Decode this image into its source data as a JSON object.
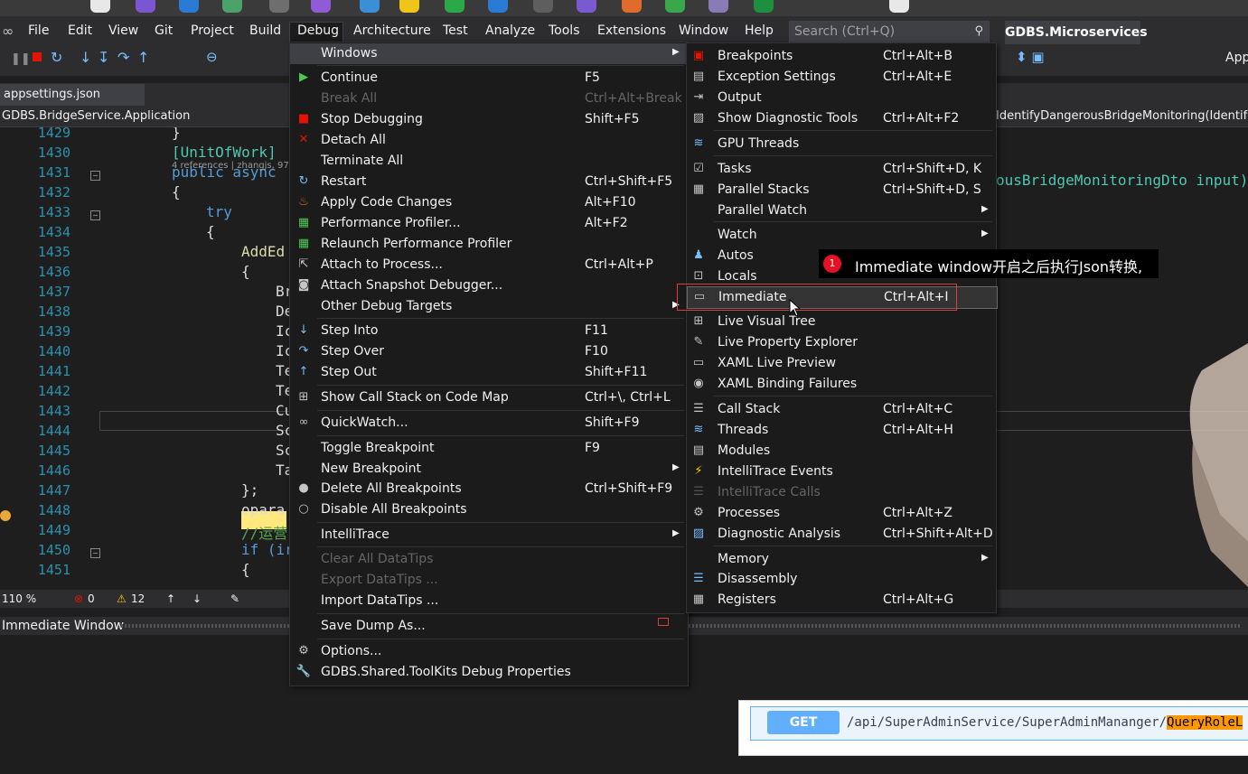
{
  "taskbar": {
    "icons": [
      "app-1",
      "app-2",
      "app-3",
      "app-4",
      "app-5",
      "app-6",
      "app-7",
      "app-8",
      "app-9",
      "app-10",
      "app-11",
      "app-12",
      "app-13",
      "app-14",
      "app-15",
      "app-16",
      "app-17"
    ]
  },
  "menubar": {
    "items": [
      "File",
      "Edit",
      "View",
      "Git",
      "Project",
      "Build",
      "Debug",
      "Architecture",
      "Test",
      "Analyze",
      "Tools",
      "Extensions",
      "Window",
      "Help"
    ],
    "search_placeholder": "Search (Ctrl+Q)",
    "solution_name": "GDBS.Microservices",
    "toolbar_right_label": "App"
  },
  "tabs": {
    "active": "appsettings.json"
  },
  "navbar": {
    "left": "GDBS.BridgeService.Application",
    "right": "IdentifyDangerousBridgeMonitoring(Identif"
  },
  "editor": {
    "lines": [
      {
        "num": "1429",
        "code": "}"
      },
      {
        "num": "1430",
        "code": "[UnitOfWork]"
      },
      {
        "num": "1431",
        "code": "public async"
      },
      {
        "num": "1432",
        "code": "{"
      },
      {
        "num": "1433",
        "code": "try"
      },
      {
        "num": "1434",
        "code": "{"
      },
      {
        "num": "1435",
        "code": "AddEd"
      },
      {
        "num": "1436",
        "code": "{"
      },
      {
        "num": "1437",
        "code": "Br"
      },
      {
        "num": "1438",
        "code": "De"
      },
      {
        "num": "1439",
        "code": "Ic"
      },
      {
        "num": "1440",
        "code": "Ic"
      },
      {
        "num": "1441",
        "code": "Te"
      },
      {
        "num": "1442",
        "code": "Te"
      },
      {
        "num": "1443",
        "code": "Cu"
      },
      {
        "num": "1444",
        "code": "Sc"
      },
      {
        "num": "1445",
        "code": "Sc"
      },
      {
        "num": "1446",
        "code": "Ta"
      },
      {
        "num": "1447",
        "code": "};"
      },
      {
        "num": "1448",
        "code": "opara"
      },
      {
        "num": "1449",
        "code": "//运营"
      },
      {
        "num": "1450",
        "code": "if (ir"
      },
      {
        "num": "1451",
        "code": "{"
      }
    ],
    "references_hint": "4 references | zhangjs, 97 d",
    "right_fragment": "ousBridgeMonitoringDto input)"
  },
  "status": {
    "zoom": "110 %",
    "errors": "0",
    "warnings": "12"
  },
  "immediate": {
    "title": "Immediate Window"
  },
  "swagger": {
    "method": "GET",
    "path": "/api/SuperAdminService/SuperAdminMananger/",
    "path_highlight": "QueryRoleL"
  },
  "debug_menu": {
    "items": [
      {
        "label": "Windows",
        "shortcut": "",
        "submenu": true,
        "icon": "none",
        "state": "highlighted"
      },
      {
        "label": "Continue",
        "shortcut": "F5",
        "icon": "play-icon"
      },
      {
        "label": "Break All",
        "shortcut": "Ctrl+Alt+Break",
        "icon": "none",
        "state": "disabled"
      },
      {
        "label": "Stop Debugging",
        "shortcut": "Shift+F5",
        "icon": "stop-icon"
      },
      {
        "label": "Detach All",
        "shortcut": "",
        "icon": "close-icon"
      },
      {
        "label": "Terminate All",
        "shortcut": "",
        "icon": "none"
      },
      {
        "label": "Restart",
        "shortcut": "Ctrl+Shift+F5",
        "icon": "restart-icon"
      },
      {
        "label": "Apply Code Changes",
        "shortcut": "Alt+F10",
        "icon": "flame-icon"
      },
      {
        "label": "Performance Profiler...",
        "shortcut": "Alt+F2",
        "icon": "profiler-icon"
      },
      {
        "label": "Relaunch Performance Profiler",
        "shortcut": "",
        "icon": "profiler-icon"
      },
      {
        "label": "Attach to Process...",
        "shortcut": "Ctrl+Alt+P",
        "icon": "attach-icon"
      },
      {
        "label": "Attach Snapshot Debugger...",
        "shortcut": "",
        "icon": "camera-icon"
      },
      {
        "label": "Other Debug Targets",
        "shortcut": "",
        "submenu": true,
        "icon": "none"
      },
      {
        "label": "Step Into",
        "shortcut": "F11",
        "icon": "step-into-icon"
      },
      {
        "label": "Step Over",
        "shortcut": "F10",
        "icon": "step-over-icon"
      },
      {
        "label": "Step Out",
        "shortcut": "Shift+F11",
        "icon": "step-out-icon"
      },
      {
        "label": "Show Call Stack on Code Map",
        "shortcut": "Ctrl+\\, Ctrl+L",
        "icon": "codemap-icon"
      },
      {
        "label": "QuickWatch...",
        "shortcut": "Shift+F9",
        "icon": "glasses-icon"
      },
      {
        "label": "Toggle Breakpoint",
        "shortcut": "F9",
        "icon": "none"
      },
      {
        "label": "New Breakpoint",
        "shortcut": "",
        "submenu": true,
        "icon": "none"
      },
      {
        "label": "Delete All Breakpoints",
        "shortcut": "Ctrl+Shift+F9",
        "icon": "delete-breakpoints-icon"
      },
      {
        "label": "Disable All Breakpoints",
        "shortcut": "",
        "icon": "disable-breakpoints-icon"
      },
      {
        "label": "IntelliTrace",
        "shortcut": "",
        "submenu": true,
        "icon": "none"
      },
      {
        "label": "Clear All DataTips",
        "shortcut": "",
        "icon": "none",
        "state": "disabled"
      },
      {
        "label": "Export DataTips ...",
        "shortcut": "",
        "icon": "none",
        "state": "disabled"
      },
      {
        "label": "Import DataTips ...",
        "shortcut": "",
        "icon": "none"
      },
      {
        "label": "Save Dump As...",
        "shortcut": "",
        "icon": "none"
      },
      {
        "label": "Options...",
        "shortcut": "",
        "icon": "gear-icon"
      },
      {
        "label": "GDBS.Shared.ToolKits Debug Properties",
        "shortcut": "",
        "icon": "wrench-icon"
      }
    ]
  },
  "windows_menu": {
    "items": [
      {
        "label": "Breakpoints",
        "shortcut": "Ctrl+Alt+B",
        "icon": "breakpoints-icon"
      },
      {
        "label": "Exception Settings",
        "shortcut": "Ctrl+Alt+E",
        "icon": "exception-icon"
      },
      {
        "label": "Output",
        "shortcut": "",
        "icon": "output-icon"
      },
      {
        "label": "Show Diagnostic Tools",
        "shortcut": "Ctrl+Alt+F2",
        "icon": "diagnostic-icon"
      },
      {
        "label": "GPU Threads",
        "shortcut": "",
        "icon": "gpu-threads-icon"
      },
      {
        "label": "Tasks",
        "shortcut": "Ctrl+Shift+D, K",
        "icon": "tasks-icon"
      },
      {
        "label": "Parallel Stacks",
        "shortcut": "Ctrl+Shift+D, S",
        "icon": "parallel-stacks-icon"
      },
      {
        "label": "Parallel Watch",
        "shortcut": "",
        "submenu": true,
        "icon": "none"
      },
      {
        "label": "Watch",
        "shortcut": "",
        "submenu": true,
        "icon": "none"
      },
      {
        "label": "Autos",
        "shortcut": "",
        "icon": "autos-icon"
      },
      {
        "label": "Locals",
        "shortcut": "",
        "icon": "locals-icon"
      },
      {
        "label": "Immediate",
        "shortcut": "Ctrl+Alt+I",
        "icon": "immediate-icon",
        "state": "highlighted"
      },
      {
        "label": "Live Visual Tree",
        "shortcut": "",
        "icon": "visual-tree-icon"
      },
      {
        "label": "Live Property Explorer",
        "shortcut": "",
        "icon": "property-explorer-icon"
      },
      {
        "label": "XAML Live Preview",
        "shortcut": "",
        "icon": "xaml-preview-icon"
      },
      {
        "label": "XAML Binding Failures",
        "shortcut": "",
        "icon": "xaml-binding-icon"
      },
      {
        "label": "Call Stack",
        "shortcut": "Ctrl+Alt+C",
        "icon": "call-stack-icon"
      },
      {
        "label": "Threads",
        "shortcut": "Ctrl+Alt+H",
        "icon": "threads-icon"
      },
      {
        "label": "Modules",
        "shortcut": "",
        "icon": "modules-icon"
      },
      {
        "label": "IntelliTrace Events",
        "shortcut": "",
        "icon": "lightning-icon"
      },
      {
        "label": "IntelliTrace Calls",
        "shortcut": "",
        "icon": "intellitrace-calls-icon",
        "state": "disabled"
      },
      {
        "label": "Processes",
        "shortcut": "Ctrl+Alt+Z",
        "icon": "processes-icon"
      },
      {
        "label": "Diagnostic Analysis",
        "shortcut": "Ctrl+Shift+Alt+D",
        "icon": "analysis-icon"
      },
      {
        "label": "Memory",
        "shortcut": "",
        "submenu": true,
        "icon": "none"
      },
      {
        "label": "Disassembly",
        "shortcut": "",
        "icon": "disassembly-icon"
      },
      {
        "label": "Registers",
        "shortcut": "Ctrl+Alt+G",
        "icon": "registers-icon"
      }
    ]
  },
  "annotation": {
    "number": "1",
    "text": "Immediate window开启之后执行Json转换,"
  }
}
